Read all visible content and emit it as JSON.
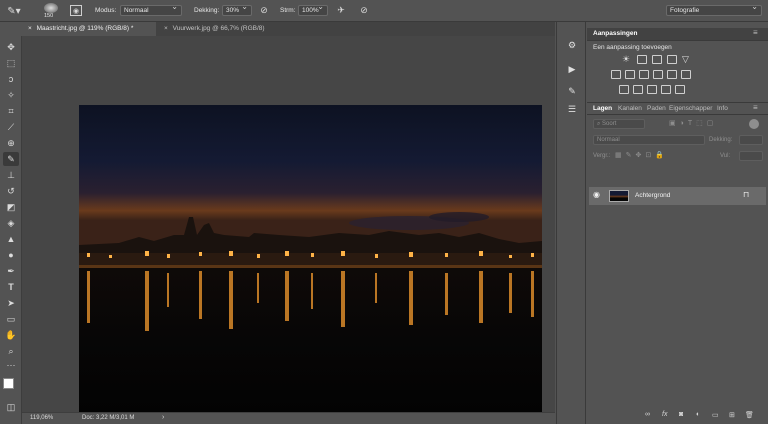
{
  "options_bar": {
    "brush_size": "150",
    "mode_label": "Modus:",
    "mode_value": "Normaal",
    "opacity_label": "Dekking:",
    "opacity_value": "30%",
    "flow_label": "Strm:",
    "flow_value": "100%",
    "workspace": "Fotografie"
  },
  "tabs": [
    {
      "label": "Maastricht.jpg @ 119% (RGB/8) *",
      "active": true
    },
    {
      "label": "Vuurwerk.jpg @ 66,7% (RGB/8)",
      "active": false
    }
  ],
  "status": {
    "zoom": "119,06%",
    "doc": "Doc: 3,22 M/3,01 M"
  },
  "panels": {
    "adjustments": {
      "tab": "Aanpassingen",
      "add_label": "Een aanpassing toevoegen"
    },
    "layers_tabs": [
      "Lagen",
      "Kanalen",
      "Paden",
      "Eigenschapper",
      "Info"
    ],
    "kind_filter": "Soort",
    "blend_mode": "Normaal",
    "opacity_label": "Dekking:",
    "lock_label": "Vergr.:",
    "fill_label": "Vul:",
    "layers": [
      {
        "name": "Achtergrond",
        "visible": true,
        "locked": true
      }
    ]
  },
  "icons": {
    "close_tab": "×",
    "eye": "👁",
    "lock": "🔒"
  }
}
